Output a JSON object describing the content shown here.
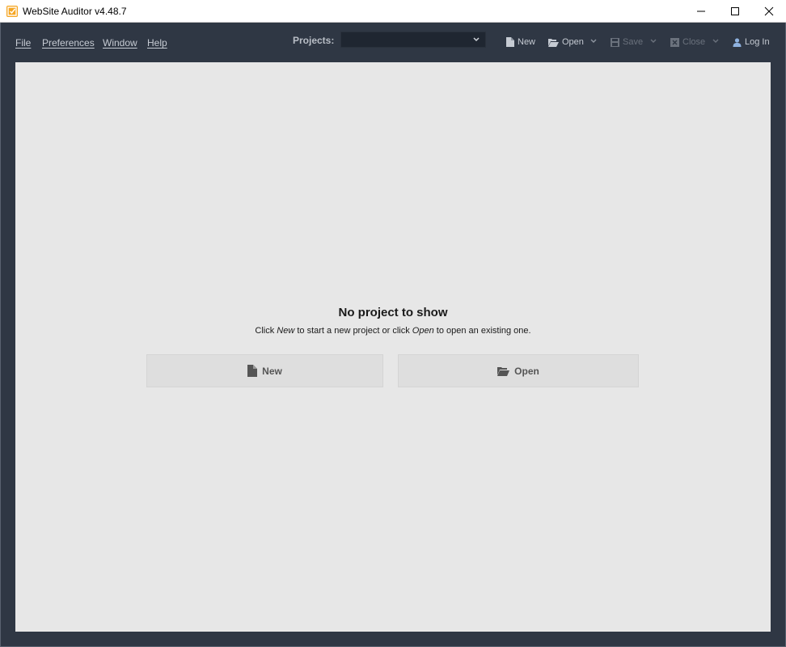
{
  "window": {
    "title": "WebSite Auditor v4.48.7",
    "controls": [
      "minimize",
      "maximize",
      "close"
    ]
  },
  "menu": {
    "items": [
      {
        "key": "F",
        "rest": "ile"
      },
      {
        "key": "P",
        "rest": "references"
      },
      {
        "key": "W",
        "rest": "indow"
      },
      {
        "key": "H",
        "rest": "elp"
      }
    ]
  },
  "toolbar": {
    "projects_label": "Projects:",
    "projects_value": "",
    "new_label": "New",
    "open_label": "Open",
    "save_label": "Save",
    "close_label": "Close",
    "login_label": "Log In"
  },
  "empty_state": {
    "title": "No project to show",
    "sub_click": "Click ",
    "sub_new": "New",
    "sub_mid": " to start a new project or click ",
    "sub_open": "Open",
    "sub_end": " to open an existing one.",
    "new_button": "New",
    "open_button": "Open"
  },
  "colors": {
    "frame": "#2f3744",
    "content_bg": "#e7e7e7",
    "app_icon": "#f5a623"
  }
}
